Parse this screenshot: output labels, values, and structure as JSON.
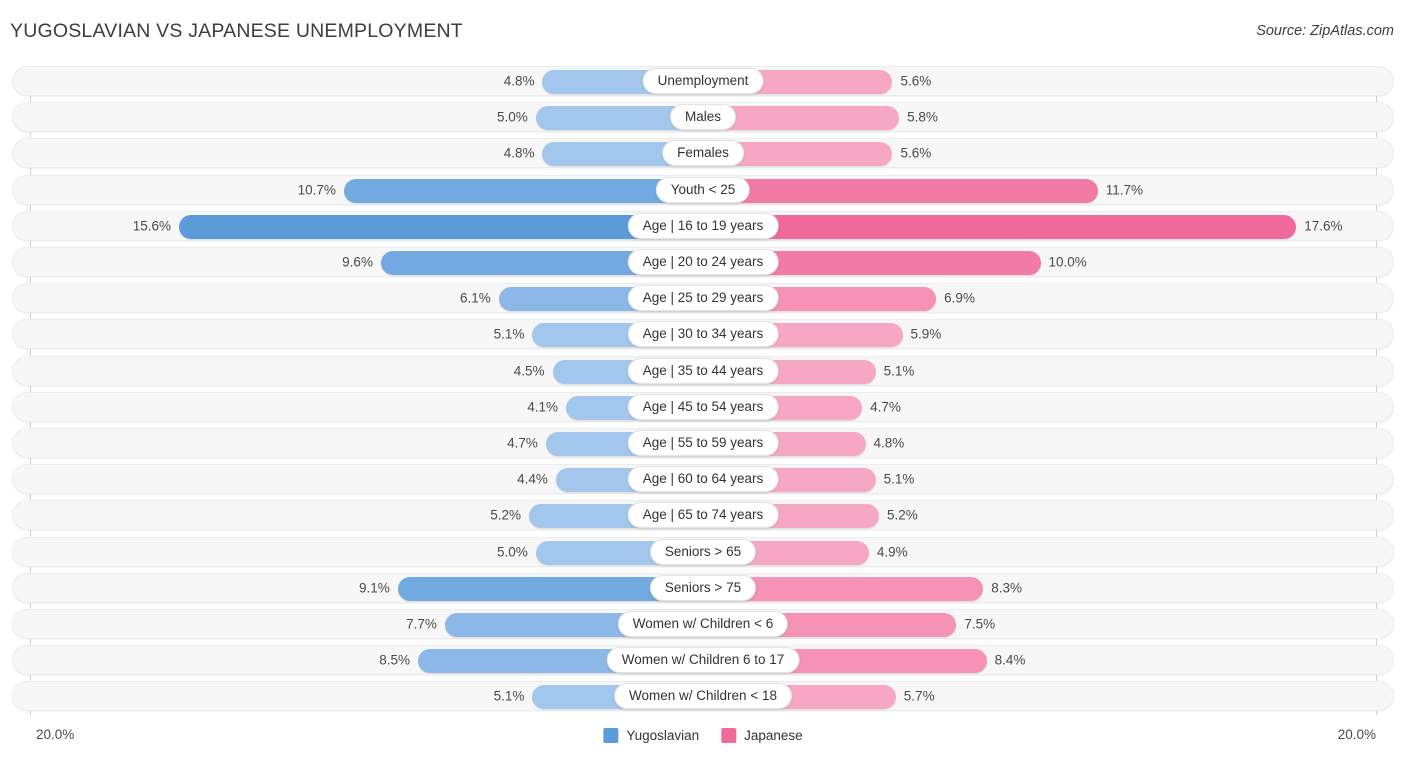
{
  "header": {
    "title": "YUGOSLAVIAN VS JAPANESE UNEMPLOYMENT",
    "source": "Source: ZipAtlas.com"
  },
  "footer": {
    "axis_left": "20.0%",
    "axis_right": "20.0%",
    "legend": [
      {
        "label": "Yugoslavian",
        "color": "#5b9bd9"
      },
      {
        "label": "Japanese",
        "color": "#f0699b"
      }
    ]
  },
  "colors": {
    "left_light": "#a3c6ec",
    "left_mid": "#8bb8e6",
    "left_strong": "#72a9e0",
    "left_dark": "#5b9bd9",
    "right_light": "#f6a7c3",
    "right_mid": "#f592b5",
    "right_strong": "#f27ba6",
    "right_dark": "#f0699b",
    "track": "#f7f7f7",
    "axis": "#d0d0d0"
  },
  "chart_data": {
    "type": "bar",
    "subtype": "diverging-bidirectional",
    "title": "YUGOSLAVIAN VS JAPANESE UNEMPLOYMENT",
    "xlabel": "",
    "ylabel": "",
    "xlim": [
      20.0,
      20.0
    ],
    "axis_max_percent": 20.0,
    "grid": false,
    "legend_position": "bottom-center",
    "categories": [
      "Unemployment",
      "Males",
      "Females",
      "Youth < 25",
      "Age | 16 to 19 years",
      "Age | 20 to 24 years",
      "Age | 25 to 29 years",
      "Age | 30 to 34 years",
      "Age | 35 to 44 years",
      "Age | 45 to 54 years",
      "Age | 55 to 59 years",
      "Age | 60 to 64 years",
      "Age | 65 to 74 years",
      "Seniors > 65",
      "Seniors > 75",
      "Women w/ Children < 6",
      "Women w/ Children 6 to 17",
      "Women w/ Children < 18"
    ],
    "series": [
      {
        "name": "Yugoslavian",
        "side": "left",
        "values": [
          4.8,
          5.0,
          4.8,
          10.7,
          15.6,
          9.6,
          6.1,
          5.1,
          4.5,
          4.1,
          4.7,
          4.4,
          5.2,
          5.0,
          9.1,
          7.7,
          8.5,
          5.1
        ],
        "labels": [
          "4.8%",
          "5.0%",
          "4.8%",
          "10.7%",
          "15.6%",
          "9.6%",
          "6.1%",
          "5.1%",
          "4.5%",
          "4.1%",
          "4.7%",
          "4.4%",
          "5.2%",
          "5.0%",
          "9.1%",
          "7.7%",
          "8.5%",
          "5.1%"
        ]
      },
      {
        "name": "Japanese",
        "side": "right",
        "values": [
          5.6,
          5.8,
          5.6,
          11.7,
          17.6,
          10.0,
          6.9,
          5.9,
          5.1,
          4.7,
          4.8,
          5.1,
          5.2,
          4.9,
          8.3,
          7.5,
          8.4,
          5.7
        ],
        "labels": [
          "5.6%",
          "5.8%",
          "5.6%",
          "11.7%",
          "17.6%",
          "10.0%",
          "6.9%",
          "5.9%",
          "5.1%",
          "4.7%",
          "4.8%",
          "5.1%",
          "5.2%",
          "4.9%",
          "8.3%",
          "7.5%",
          "8.4%",
          "5.7%"
        ]
      }
    ]
  }
}
